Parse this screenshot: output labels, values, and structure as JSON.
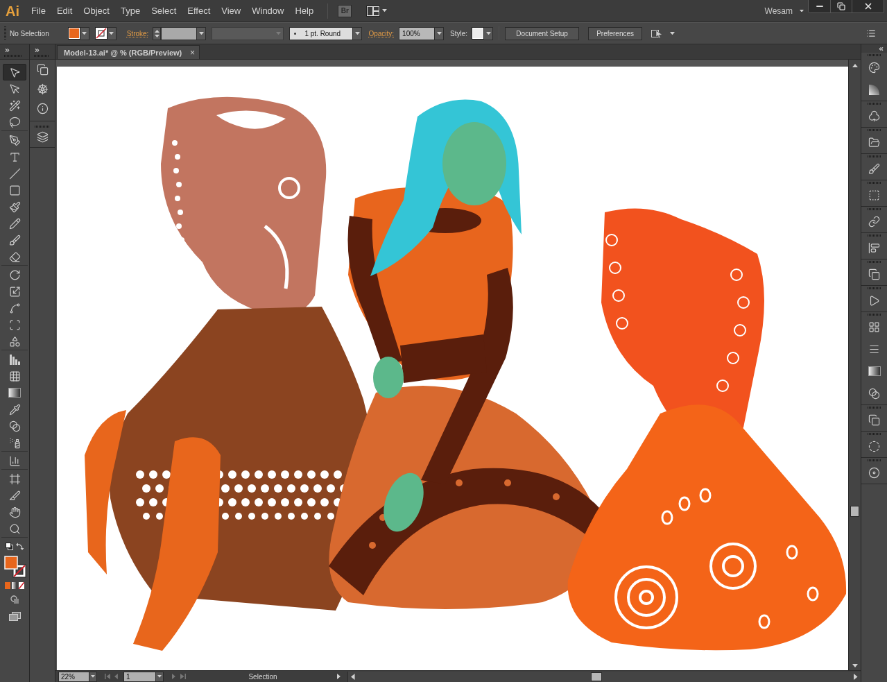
{
  "app": {
    "logo": "Ai"
  },
  "menu_bar": {
    "items": [
      "File",
      "Edit",
      "Object",
      "Type",
      "Select",
      "Effect",
      "View",
      "Window",
      "Help"
    ],
    "bridge_button": "Br",
    "workspace": "Wesam"
  },
  "control_bar": {
    "selection": "No Selection",
    "stroke_label": "Stroke:",
    "width_profile": {
      "disabled": true
    },
    "brush": "1 pt. Round",
    "opacity_label": "Opacity:",
    "opacity": "100%",
    "style_label": "Style:",
    "buttons": [
      "Document Setup",
      "Preferences"
    ]
  },
  "document_tab": {
    "title": "Model-13.ai* @ % (RGB/Preview)",
    "close": "×"
  },
  "tools": [
    {
      "kind": "selection",
      "selected": true
    },
    {
      "kind": "direct-selection",
      "selected": false
    },
    {
      "kind": "magic-wand",
      "selected": false
    },
    {
      "kind": "lasso",
      "selected": false
    },
    {
      "kind": "pen",
      "selected": false
    },
    {
      "kind": "type",
      "selected": false
    },
    {
      "kind": "line",
      "selected": false
    },
    {
      "kind": "rectangle",
      "selected": false
    },
    {
      "kind": "paintbrush",
      "selected": false
    },
    {
      "kind": "pencil",
      "selected": false
    },
    {
      "kind": "blob-brush",
      "selected": false
    },
    {
      "kind": "eraser",
      "selected": false
    },
    {
      "kind": "rotate",
      "selected": false
    },
    {
      "kind": "scale",
      "selected": false
    },
    {
      "kind": "width",
      "selected": false
    },
    {
      "kind": "free-transform",
      "selected": false
    },
    {
      "kind": "shape-builder",
      "selected": false
    },
    {
      "kind": "perspective-grid",
      "selected": false
    },
    {
      "kind": "mesh",
      "selected": false
    },
    {
      "kind": "gradient",
      "selected": false
    },
    {
      "kind": "eyedropper",
      "selected": false
    },
    {
      "kind": "blend",
      "selected": false
    },
    {
      "kind": "symbol-sprayer",
      "selected": false
    },
    {
      "kind": "column-graph",
      "selected": false
    },
    {
      "kind": "artboard",
      "selected": false
    },
    {
      "kind": "slice",
      "selected": false
    },
    {
      "kind": "hand",
      "selected": false
    },
    {
      "kind": "zoom",
      "selected": false
    }
  ],
  "status_bar": {
    "zoom": "22%",
    "page": "1",
    "status": "Selection"
  }
}
